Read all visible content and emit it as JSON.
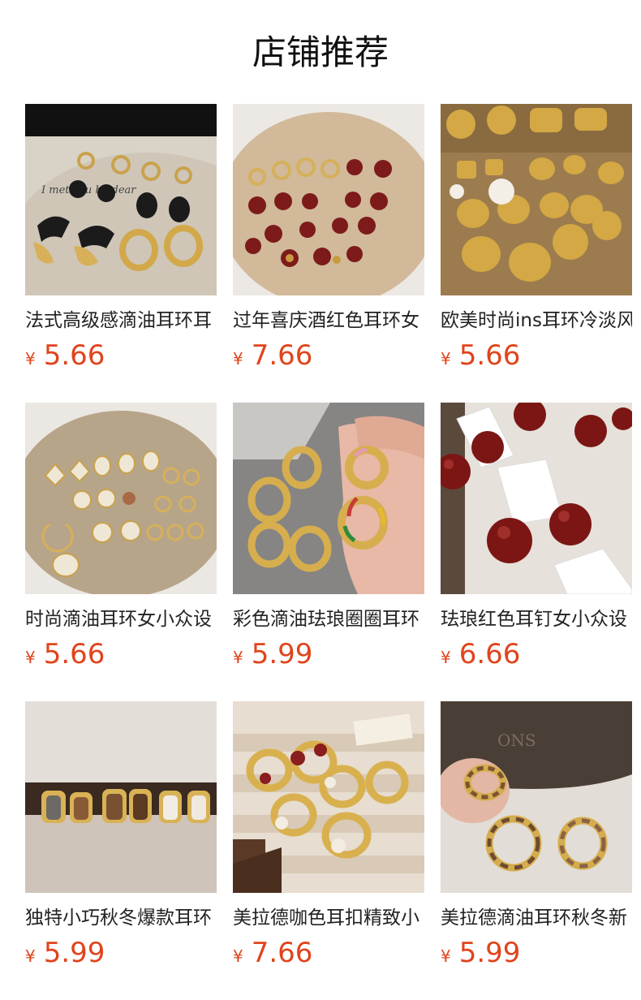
{
  "page": {
    "title": "店铺推荐"
  },
  "colors": {
    "price": "#e0441c",
    "title": "#111111"
  },
  "products": [
    {
      "name": "法式高级感滴油耳环耳",
      "currency": "¥",
      "price": "5.66",
      "image": "black-enamel-hoops-on-plate"
    },
    {
      "name": "过年喜庆酒红色耳环女",
      "currency": "¥",
      "price": "7.66",
      "image": "wine-red-studs-on-plate"
    },
    {
      "name": "欧美时尚ins耳环冷淡风",
      "currency": "¥",
      "price": "5.66",
      "image": "gold-matte-studs-with-pearls"
    },
    {
      "name": "时尚滴油耳环女小众设",
      "currency": "¥",
      "price": "5.66",
      "image": "white-enamel-earrings-on-plate"
    },
    {
      "name": "彩色滴油珐琅圈圈耳环",
      "currency": "¥",
      "price": "5.99",
      "image": "colorful-enamel-hoops-in-hand"
    },
    {
      "name": "珐琅红色耳钉女小众设",
      "currency": "¥",
      "price": "6.66",
      "image": "red-ball-studs-on-cards"
    },
    {
      "name": "独特小巧秋冬爆款耳环",
      "currency": "¥",
      "price": "5.99",
      "image": "enamel-huggie-earrings-row"
    },
    {
      "name": "美拉德咖色耳扣精致小",
      "currency": "¥",
      "price": "7.66",
      "image": "maillard-brown-hoops-in-tray"
    },
    {
      "name": "美拉德滴油耳环秋冬新",
      "currency": "¥",
      "price": "5.99",
      "image": "maillard-enamel-hoops-on-fur"
    }
  ]
}
